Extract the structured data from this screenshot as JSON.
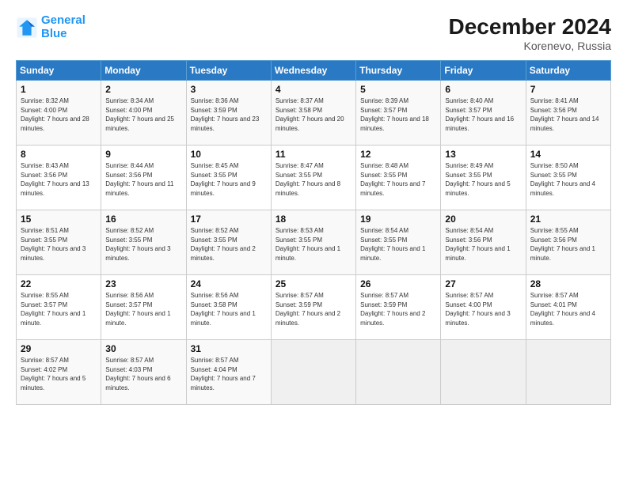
{
  "logo": {
    "line1": "General",
    "line2": "Blue"
  },
  "title": "December 2024",
  "subtitle": "Korenevo, Russia",
  "header": {
    "days": [
      "Sunday",
      "Monday",
      "Tuesday",
      "Wednesday",
      "Thursday",
      "Friday",
      "Saturday"
    ]
  },
  "weeks": [
    [
      {
        "day": "1",
        "sunrise": "8:32 AM",
        "sunset": "4:00 PM",
        "daylight": "7 hours and 28 minutes."
      },
      {
        "day": "2",
        "sunrise": "8:34 AM",
        "sunset": "4:00 PM",
        "daylight": "7 hours and 25 minutes."
      },
      {
        "day": "3",
        "sunrise": "8:36 AM",
        "sunset": "3:59 PM",
        "daylight": "7 hours and 23 minutes."
      },
      {
        "day": "4",
        "sunrise": "8:37 AM",
        "sunset": "3:58 PM",
        "daylight": "7 hours and 20 minutes."
      },
      {
        "day": "5",
        "sunrise": "8:39 AM",
        "sunset": "3:57 PM",
        "daylight": "7 hours and 18 minutes."
      },
      {
        "day": "6",
        "sunrise": "8:40 AM",
        "sunset": "3:57 PM",
        "daylight": "7 hours and 16 minutes."
      },
      {
        "day": "7",
        "sunrise": "8:41 AM",
        "sunset": "3:56 PM",
        "daylight": "7 hours and 14 minutes."
      }
    ],
    [
      {
        "day": "8",
        "sunrise": "8:43 AM",
        "sunset": "3:56 PM",
        "daylight": "7 hours and 13 minutes."
      },
      {
        "day": "9",
        "sunrise": "8:44 AM",
        "sunset": "3:56 PM",
        "daylight": "7 hours and 11 minutes."
      },
      {
        "day": "10",
        "sunrise": "8:45 AM",
        "sunset": "3:55 PM",
        "daylight": "7 hours and 9 minutes."
      },
      {
        "day": "11",
        "sunrise": "8:47 AM",
        "sunset": "3:55 PM",
        "daylight": "7 hours and 8 minutes."
      },
      {
        "day": "12",
        "sunrise": "8:48 AM",
        "sunset": "3:55 PM",
        "daylight": "7 hours and 7 minutes."
      },
      {
        "day": "13",
        "sunrise": "8:49 AM",
        "sunset": "3:55 PM",
        "daylight": "7 hours and 5 minutes."
      },
      {
        "day": "14",
        "sunrise": "8:50 AM",
        "sunset": "3:55 PM",
        "daylight": "7 hours and 4 minutes."
      }
    ],
    [
      {
        "day": "15",
        "sunrise": "8:51 AM",
        "sunset": "3:55 PM",
        "daylight": "7 hours and 3 minutes."
      },
      {
        "day": "16",
        "sunrise": "8:52 AM",
        "sunset": "3:55 PM",
        "daylight": "7 hours and 3 minutes."
      },
      {
        "day": "17",
        "sunrise": "8:52 AM",
        "sunset": "3:55 PM",
        "daylight": "7 hours and 2 minutes."
      },
      {
        "day": "18",
        "sunrise": "8:53 AM",
        "sunset": "3:55 PM",
        "daylight": "7 hours and 1 minute."
      },
      {
        "day": "19",
        "sunrise": "8:54 AM",
        "sunset": "3:55 PM",
        "daylight": "7 hours and 1 minute."
      },
      {
        "day": "20",
        "sunrise": "8:54 AM",
        "sunset": "3:56 PM",
        "daylight": "7 hours and 1 minute."
      },
      {
        "day": "21",
        "sunrise": "8:55 AM",
        "sunset": "3:56 PM",
        "daylight": "7 hours and 1 minute."
      }
    ],
    [
      {
        "day": "22",
        "sunrise": "8:55 AM",
        "sunset": "3:57 PM",
        "daylight": "7 hours and 1 minute."
      },
      {
        "day": "23",
        "sunrise": "8:56 AM",
        "sunset": "3:57 PM",
        "daylight": "7 hours and 1 minute."
      },
      {
        "day": "24",
        "sunrise": "8:56 AM",
        "sunset": "3:58 PM",
        "daylight": "7 hours and 1 minute."
      },
      {
        "day": "25",
        "sunrise": "8:57 AM",
        "sunset": "3:59 PM",
        "daylight": "7 hours and 2 minutes."
      },
      {
        "day": "26",
        "sunrise": "8:57 AM",
        "sunset": "3:59 PM",
        "daylight": "7 hours and 2 minutes."
      },
      {
        "day": "27",
        "sunrise": "8:57 AM",
        "sunset": "4:00 PM",
        "daylight": "7 hours and 3 minutes."
      },
      {
        "day": "28",
        "sunrise": "8:57 AM",
        "sunset": "4:01 PM",
        "daylight": "7 hours and 4 minutes."
      }
    ],
    [
      {
        "day": "29",
        "sunrise": "8:57 AM",
        "sunset": "4:02 PM",
        "daylight": "7 hours and 5 minutes."
      },
      {
        "day": "30",
        "sunrise": "8:57 AM",
        "sunset": "4:03 PM",
        "daylight": "7 hours and 6 minutes."
      },
      {
        "day": "31",
        "sunrise": "8:57 AM",
        "sunset": "4:04 PM",
        "daylight": "7 hours and 7 minutes."
      },
      null,
      null,
      null,
      null
    ]
  ]
}
